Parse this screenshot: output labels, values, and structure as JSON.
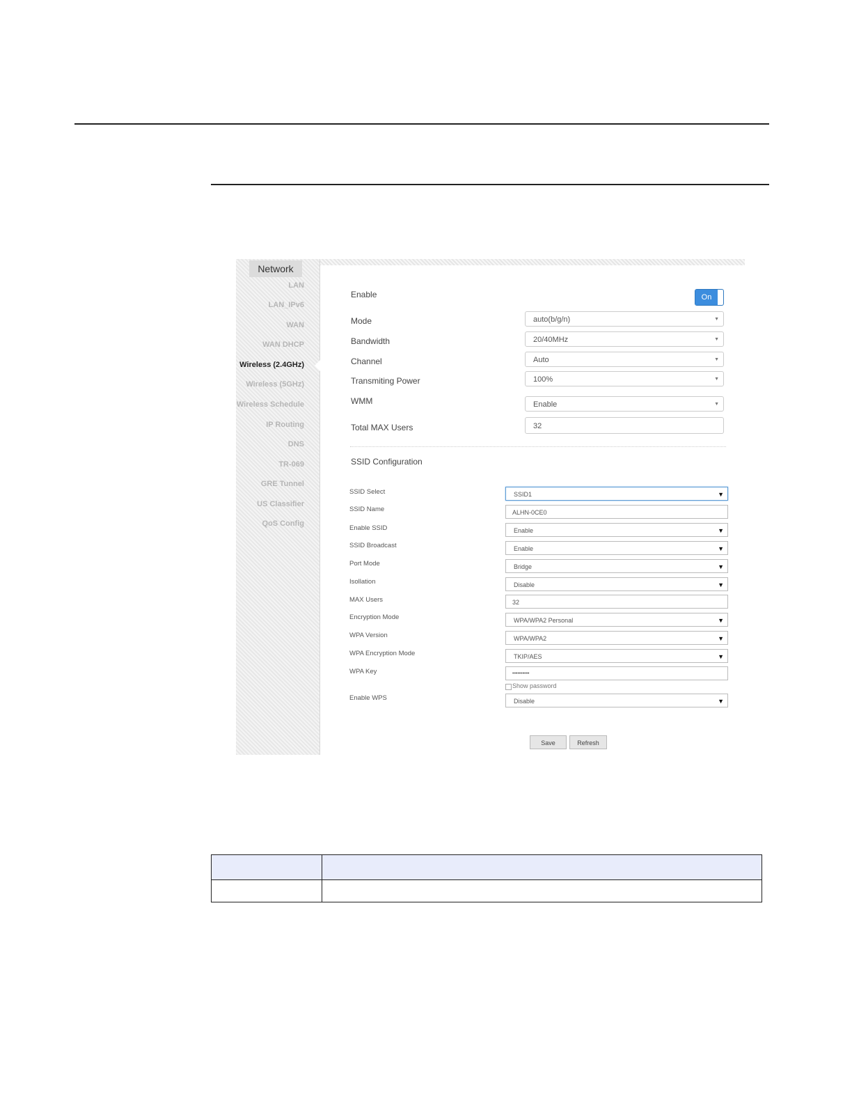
{
  "sidebar": {
    "header": "Network",
    "items": [
      {
        "label": "LAN",
        "active": false
      },
      {
        "label": "LAN_IPv6",
        "active": false
      },
      {
        "label": "WAN",
        "active": false
      },
      {
        "label": "WAN DHCP",
        "active": false
      },
      {
        "label": "Wireless (2.4GHz)",
        "active": true
      },
      {
        "label": "Wireless (5GHz)",
        "active": false
      },
      {
        "label": "Wireless Schedule",
        "active": false
      },
      {
        "label": "IP Routing",
        "active": false
      },
      {
        "label": "DNS",
        "active": false
      },
      {
        "label": "TR-069",
        "active": false
      },
      {
        "label": "GRE Tunnel",
        "active": false
      },
      {
        "label": "US Classifier",
        "active": false
      },
      {
        "label": "QoS Config",
        "active": false
      }
    ]
  },
  "radio": {
    "enable_label": "Enable",
    "enable_toggle": "On",
    "mode_label": "Mode",
    "mode_value": "auto(b/g/n)",
    "bandwidth_label": "Bandwidth",
    "bandwidth_value": "20/40MHz",
    "channel_label": "Channel",
    "channel_value": "Auto",
    "power_label": "Transmiting Power",
    "power_value": "100%",
    "wmm_label": "WMM",
    "wmm_value": "Enable",
    "max_users_label": "Total MAX Users",
    "max_users_value": "32"
  },
  "ssid": {
    "section_title": "SSID Configuration",
    "select_label": "SSID Select",
    "select_value": "SSID1",
    "name_label": "SSID Name",
    "name_value": "ALHN-0CE0",
    "enable_label": "Enable SSID",
    "enable_value": "Enable",
    "broadcast_label": "SSID Broadcast",
    "broadcast_value": "Enable",
    "port_mode_label": "Port Mode",
    "port_mode_value": "Bridge",
    "isolation_label": "Isollation",
    "isolation_value": "Disable",
    "max_users_label": "MAX Users",
    "max_users_value": "32",
    "encryption_label": "Encryption Mode",
    "encryption_value": "WPA/WPA2 Personal",
    "wpa_version_label": "WPA Version",
    "wpa_version_value": "WPA/WPA2",
    "wpa_enc_label": "WPA Encryption Mode",
    "wpa_enc_value": "TKIP/AES",
    "wpa_key_label": "WPA Key",
    "wpa_key_value": "••••••••••",
    "show_password_label": "Show password",
    "wps_label": "Enable WPS",
    "wps_value": "Disable"
  },
  "buttons": {
    "save": "Save",
    "refresh": "Refresh"
  }
}
